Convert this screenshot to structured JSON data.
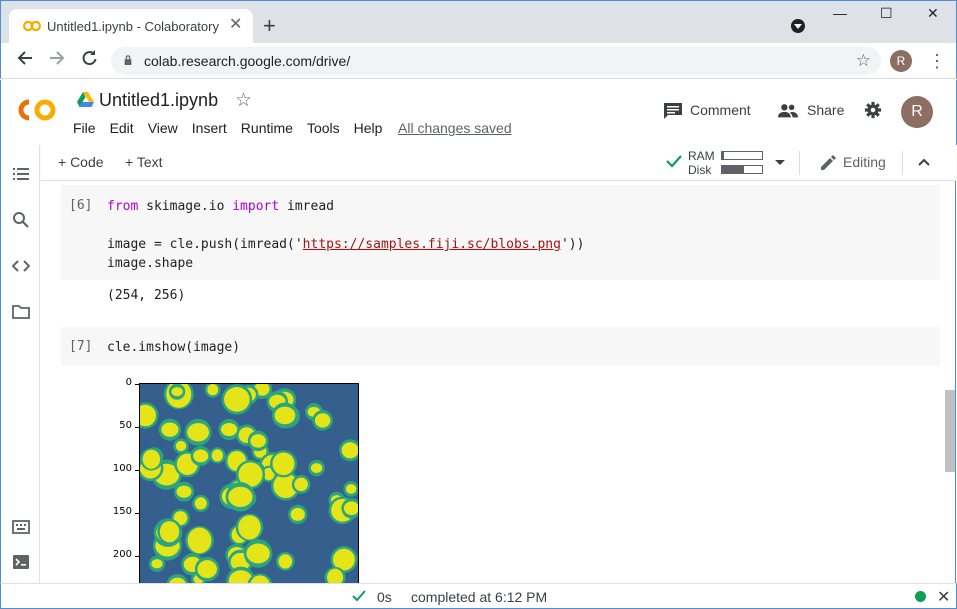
{
  "browser": {
    "tab_title": "Untitled1.ipynb - Colaboratory",
    "tab_close": "✕",
    "new_tab": "+",
    "url": "colab.research.google.com/drive/",
    "profile_initial": "R",
    "window_controls": {
      "minimize": "—",
      "maximize": "☐",
      "close": "✕"
    }
  },
  "colab": {
    "logo_text": "CO",
    "notebook_title": "Untitled1.ipynb",
    "menu": [
      "File",
      "Edit",
      "View",
      "Insert",
      "Runtime",
      "Tools",
      "Help"
    ],
    "save_status": "All changes saved",
    "comment_label": "Comment",
    "share_label": "Share",
    "user_initial": "R"
  },
  "toolbar": {
    "add_code": "+ Code",
    "add_text": "+ Text",
    "ram_label": "RAM",
    "disk_label": "Disk",
    "ram_usage": 0.05,
    "disk_usage": 0.55,
    "editing_label": "Editing"
  },
  "cells": [
    {
      "exec_count": "[6]",
      "code_lines": [
        {
          "parts": [
            {
              "t": "from",
              "c": "kw"
            },
            {
              "t": " skimage.io "
            },
            {
              "t": "import",
              "c": "kw"
            },
            {
              "t": " imread"
            }
          ]
        },
        {
          "parts": [
            {
              "t": ""
            }
          ]
        },
        {
          "parts": [
            {
              "t": "image = cle.push(imread('"
            },
            {
              "t": "https://samples.fiji.sc/blobs.png",
              "c": "str"
            },
            {
              "t": "'))"
            }
          ]
        },
        {
          "parts": [
            {
              "t": "image.shape"
            }
          ]
        }
      ],
      "output": "(254, 256)"
    },
    {
      "exec_count": "[7]",
      "code_lines": [
        {
          "parts": [
            {
              "t": "cle.imshow(image)"
            }
          ]
        }
      ]
    }
  ],
  "plot": {
    "y_ticks": [
      "0",
      "50",
      "100",
      "150",
      "200"
    ]
  },
  "status": {
    "exec_time": "0s",
    "completed_text": "completed at 6:12 PM",
    "connected_color": "#0f9d58"
  },
  "colors": {
    "accent_orange": "#f9ab00",
    "keyword": "#af00db",
    "string": "#a31515",
    "blob_bg": "#35608d",
    "blob_fg": "#e5e419"
  }
}
